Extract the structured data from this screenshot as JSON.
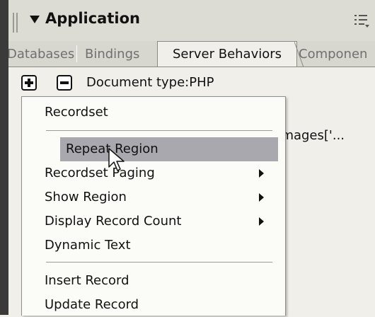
{
  "panel": {
    "title": "Application",
    "tabs": [
      "Databases",
      "Bindings",
      "Server Behaviors",
      "Componen"
    ],
    "active_tab": "Server Behaviors"
  },
  "toolbar": {
    "document_type": "Document type:PHP"
  },
  "background": {
    "partial_item": "etImages['..."
  },
  "menu": {
    "items": [
      {
        "label": "Recordset"
      },
      {
        "label": "Repeat Region",
        "highlighted": true
      },
      {
        "label": "Recordset Paging",
        "submenu": true
      },
      {
        "label": "Show Region",
        "submenu": true
      },
      {
        "label": "Display Record Count",
        "submenu": true
      },
      {
        "label": "Dynamic Text"
      },
      {
        "label": "Insert Record"
      },
      {
        "label": "Update Record"
      }
    ]
  },
  "colors": {
    "highlight": "#a8a8ae",
    "titlebar": "#dcdcd4"
  }
}
